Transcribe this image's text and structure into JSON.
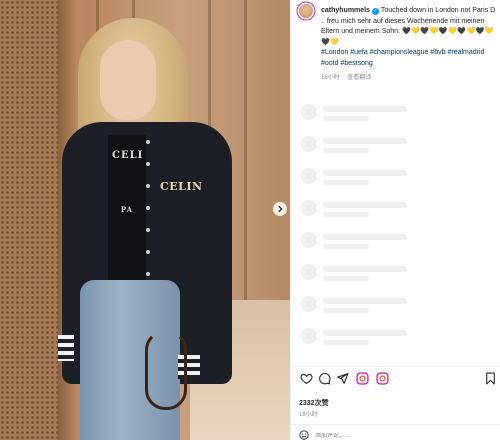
{
  "post": {
    "username": "cathyhummels",
    "caption_text": "Touched down in London not Paris D .. freu mich sehr auf dieses Wochenende mit meinen Eltern und meinem Sohn.",
    "hearts": [
      "🖤",
      "💛",
      "🖤",
      "💛",
      "🖤",
      "💛",
      "🖤",
      "💛",
      "🖤",
      "💛",
      "🖤",
      "💛"
    ],
    "hashtags": "#London #uefa #championsleague #bvb #realmadrid #ootd #bestsong",
    "caption_time": "18小时",
    "see_translation": "查看翻译",
    "likes": "2332次赞",
    "posted_time": "18小时",
    "comment_placeholder": "添加评论……"
  },
  "photo": {
    "shirt_logo": "CELI",
    "chest_logo": "CELIN",
    "back_logo": "PA"
  },
  "icons": {
    "like": "heart-icon",
    "comment": "comment-icon",
    "share": "share-icon",
    "gift1": "gift-icon",
    "gift2": "gift-icon",
    "save": "bookmark-icon",
    "next": "chevron-right-icon",
    "emoji": "emoji-icon"
  },
  "colors": {
    "link": "#00376b",
    "verified": "#0095f6",
    "muted": "#8e8e8e",
    "skeleton": "#efefef"
  }
}
